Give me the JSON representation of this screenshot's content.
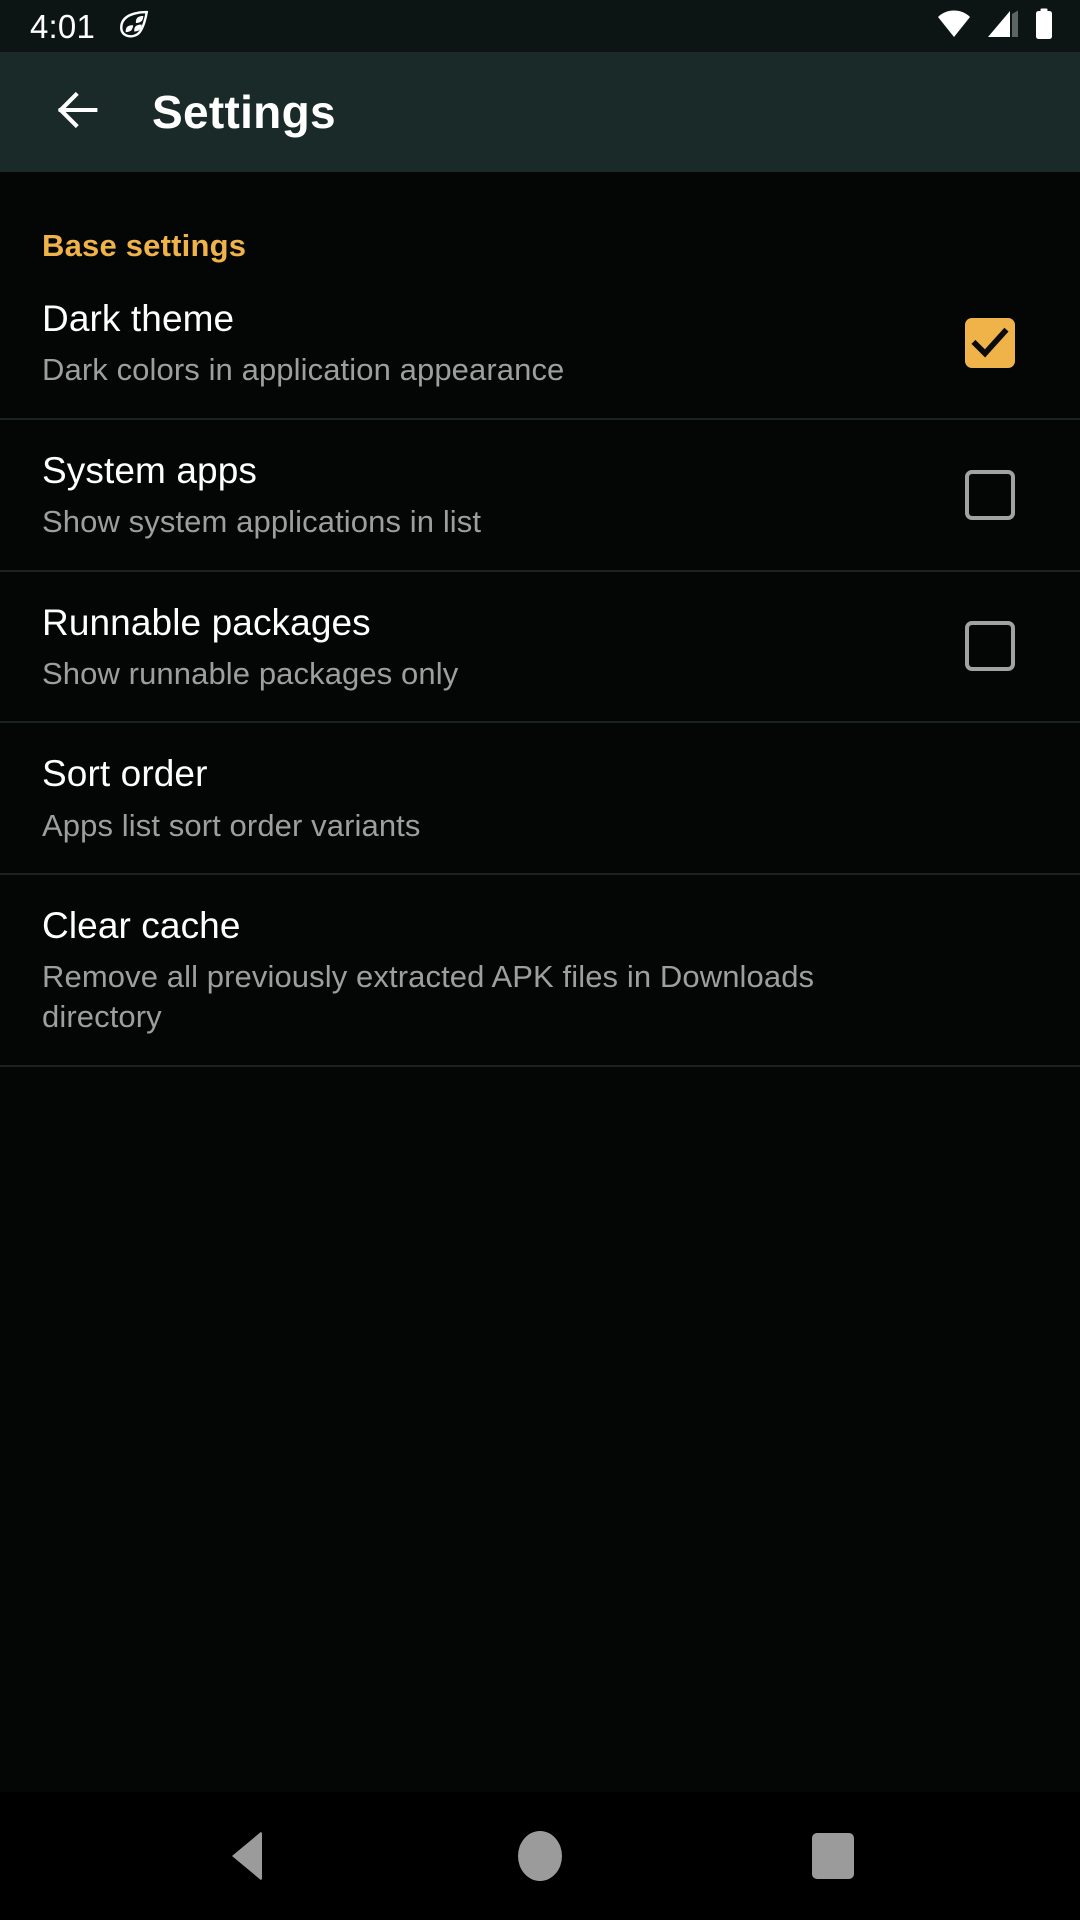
{
  "status_bar": {
    "time": "4:01",
    "icons": {
      "notification": "citrus-slice-icon",
      "wifi": "wifi-icon",
      "signal": "cellular-signal-icon",
      "battery": "battery-full-icon"
    }
  },
  "app_bar": {
    "back_icon": "arrow-back-icon",
    "title": "Settings"
  },
  "colors": {
    "accent": "#f0b34a",
    "app_bar_bg": "#1a2a29",
    "status_bar_bg": "#0d1514",
    "page_bg": "#040606",
    "title_text": "#ffffff",
    "summary_text": "#9e9e9e",
    "divider": "#1b2322",
    "nav_icon": "#9b9b9b"
  },
  "sections": [
    {
      "header": "Base settings",
      "items": [
        {
          "title": "Dark theme",
          "summary": "Dark colors in application appearance",
          "control": "checkbox",
          "checked": true
        },
        {
          "title": "System apps",
          "summary": "Show system applications in list",
          "control": "checkbox",
          "checked": false
        },
        {
          "title": "Runnable packages",
          "summary": "Show runnable packages only",
          "control": "checkbox",
          "checked": false
        },
        {
          "title": "Sort order",
          "summary": "Apps list sort order variants",
          "control": "none",
          "checked": false
        },
        {
          "title": "Clear cache",
          "summary": "Remove all previously extracted APK files in Downloads directory",
          "control": "none",
          "checked": false
        }
      ]
    }
  ],
  "nav_bar": {
    "back": "navigation-back-icon",
    "home": "navigation-home-icon",
    "recents": "navigation-recents-icon"
  }
}
